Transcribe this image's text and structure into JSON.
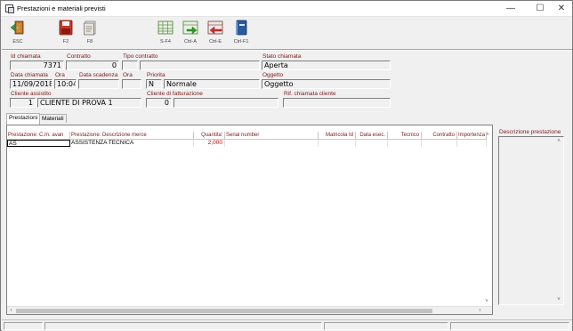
{
  "window": {
    "title": "Prestazioni e materiali previsti",
    "minimize_glyph": "—",
    "maximize_glyph": "☐",
    "close_glyph": "✕"
  },
  "toolbar": {
    "esc_label": "ESC",
    "f2_label": "F2",
    "f8_label": "F8",
    "sf4_label": "S-F4",
    "ctrla_label": "Ctrl-A",
    "ctrle_label": "Ctrl-E",
    "ctrlf1_label": "Ctrl-F1"
  },
  "header": {
    "id_chiamata_label": "Id chiamata",
    "id_chiamata_value": "7371",
    "contratto_label": "Contratto",
    "contratto_value": "0",
    "tipo_contratto_label": "Tipo contratto",
    "tipo_contratto_value": "",
    "stato_chiamata_label": "Stato chiamata",
    "stato_chiamata_value": "Aperta",
    "data_chiamata_label": "Data chiamata",
    "data_chiamata_value": "11/09/2018",
    "ora_label": "Ora",
    "ora_value": "10:04",
    "data_scadenza_label": "Data scadenza",
    "data_scadenza_value": "",
    "ora2_label": "Ora",
    "ora2_value": "",
    "priorita_label": "Priorita",
    "priorita_code": "N",
    "priorita_value": "Normale",
    "oggetto_label": "Oggetto",
    "oggetto_value": "Oggetto",
    "cliente_assistito_label": "Cliente assistito",
    "cliente_assistito_code": "1",
    "cliente_assistito_name": "CLIENTE DI PROVA 1",
    "cliente_fatturazione_label": "Cliente di fatturazione",
    "cliente_fatturazione_code": "0",
    "cliente_fatturazione_name": "",
    "rif_chiamata_label": "Rif. chiamata cliente",
    "rif_chiamata_value": ""
  },
  "tabs": [
    {
      "label": "Prestazioni",
      "active": true
    },
    {
      "label": "Materiali",
      "active": false
    }
  ],
  "grid": {
    "columns": [
      "Prestazione: C.m. avan",
      "Prestazione: Descrizione merce",
      "Quantita'",
      "Serial number",
      "Matricola Id",
      "Data esec.",
      "Tecnico",
      "Contratto",
      "Importenza"
    ],
    "rows": [
      {
        "code": "AS",
        "description": "ASSISTENZA TECNICA",
        "quantity": "2,000",
        "serial": "",
        "matricola": "",
        "data": "",
        "tecnico": "",
        "contratto": "",
        "importenza": ""
      }
    ],
    "scroll_left": "‹",
    "scroll_right": "›",
    "scroll_up": "˄",
    "scroll_down": "˅"
  },
  "description_panel": {
    "label": "Descrizione prestazione"
  },
  "colors": {
    "label": "#7a1a1a",
    "quantity": "#c00000"
  }
}
